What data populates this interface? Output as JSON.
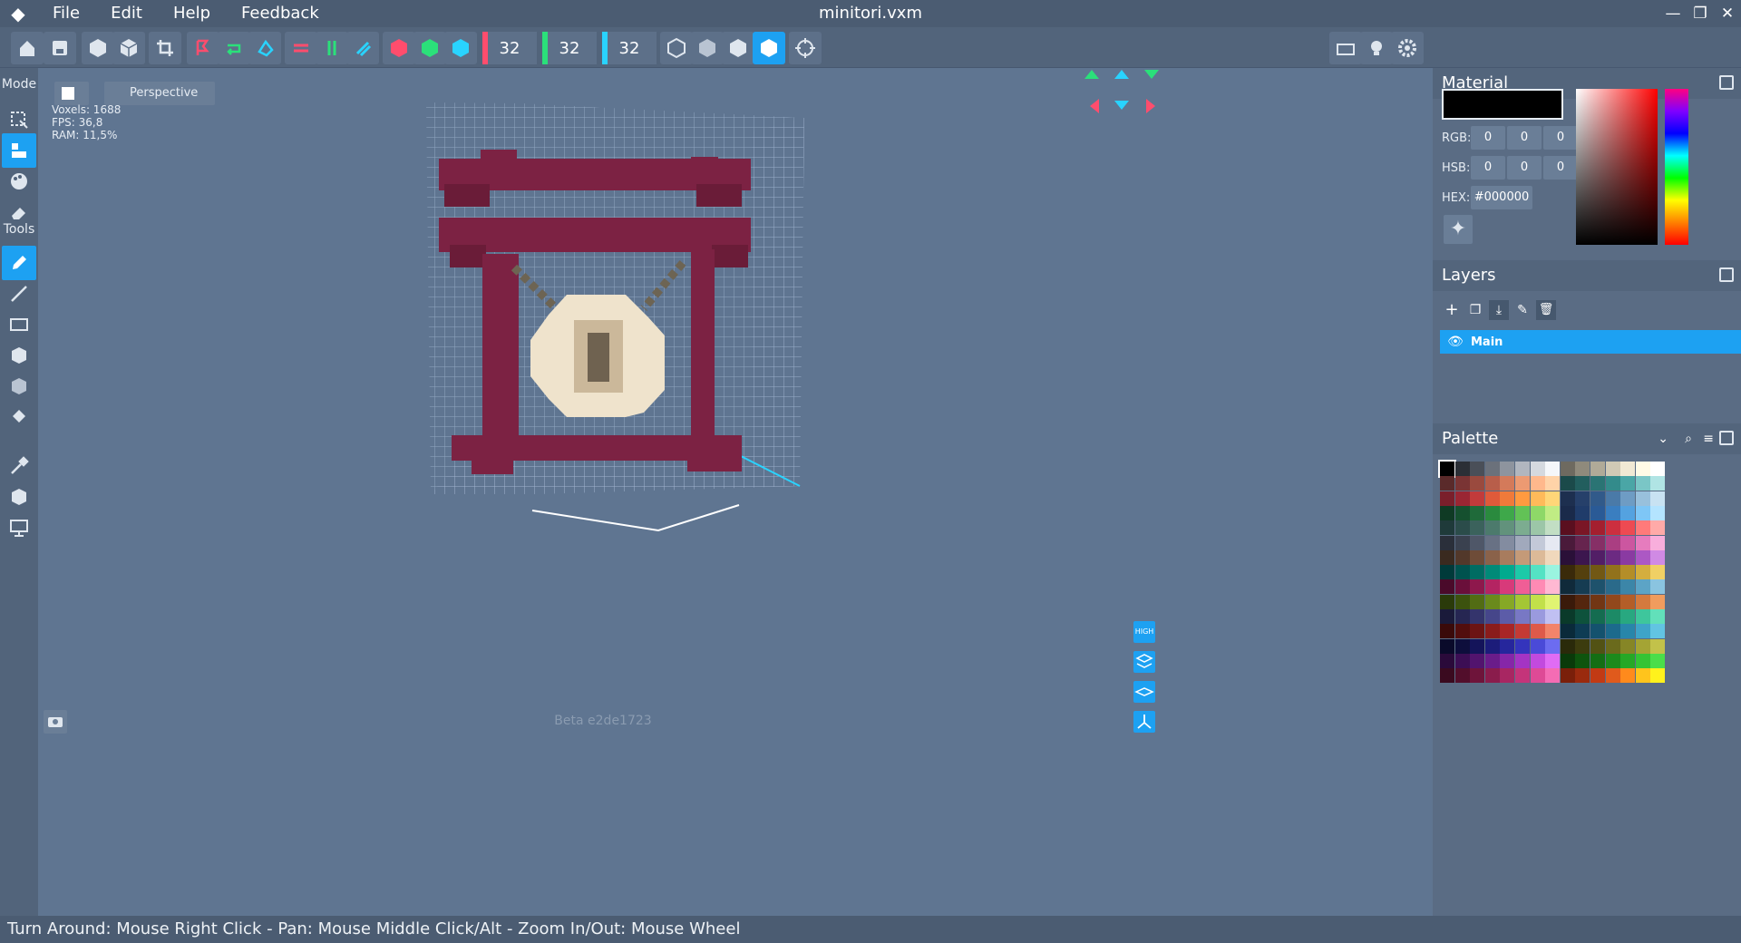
{
  "app": {
    "title": "minitori.vxm"
  },
  "menu": [
    "File",
    "Edit",
    "Help",
    "Feedback"
  ],
  "toolbar": {
    "dims": [
      "32",
      "32",
      "32"
    ],
    "dim_colors": [
      "#ff4d6d",
      "#2be07a",
      "#29d3ff"
    ]
  },
  "sidebar": {
    "mode_label": "Mode",
    "tools_label": "Tools"
  },
  "viewport": {
    "view_select": "Perspective",
    "stats": [
      "Voxels: 1688",
      "FPS: 36,8",
      "RAM: 11,5%"
    ],
    "version": "Beta e2de1723",
    "quality_badge": "HIGH"
  },
  "material": {
    "title": "Material",
    "rgb_label": "RGB:",
    "rgb": [
      "0",
      "0",
      "0"
    ],
    "hsb_label": "HSB:",
    "hsb": [
      "0",
      "0",
      "0"
    ],
    "hex_label": "HEX:",
    "hex": "#000000"
  },
  "layers": {
    "title": "Layers",
    "items": [
      "Main"
    ]
  },
  "palette": {
    "title": "Palette",
    "rows": [
      [
        "#000000",
        "#2b2f36",
        "#4a4f58",
        "#6b717b",
        "#8e949e",
        "#b1b6bf",
        "#d5d9df",
        "#f5f7fa",
        "#6e6a60",
        "#8f8a7c",
        "#b0aa98",
        "#d0c9b5",
        "#f0e9d4",
        "#fffbe6",
        "#ffffff"
      ],
      [
        "#5a2a2a",
        "#7a3434",
        "#9a4a3e",
        "#b85e4a",
        "#d47a5a",
        "#ec9a72",
        "#ffb88c",
        "#ffd3a8",
        "#1b4a4a",
        "#225e5e",
        "#2a7474",
        "#338b8b",
        "#4aa6a6",
        "#7ac6c6",
        "#b0e4e4"
      ],
      [
        "#7a1f2b",
        "#9a2633",
        "#c23b3b",
        "#e05a3a",
        "#f07a3a",
        "#ff9a40",
        "#ffba5a",
        "#ffd678",
        "#1d2f4f",
        "#26406a",
        "#315a8a",
        "#4a7aa8",
        "#6e9cc4",
        "#98c0dc",
        "#c8e2f2"
      ],
      [
        "#0f3a24",
        "#15502f",
        "#1f6a3a",
        "#2a8a3e",
        "#3ea84a",
        "#62c256",
        "#8ed868",
        "#c0ec84",
        "#1a2a4a",
        "#203c6a",
        "#2a5a96",
        "#3a7ec0",
        "#54a2e0",
        "#7ec6f6",
        "#b4e4ff"
      ],
      [
        "#1f3a3a",
        "#2b4c4a",
        "#3b625c",
        "#4c7a6c",
        "#62927c",
        "#7cac90",
        "#9cc6a8",
        "#c2dec4",
        "#5a0f1f",
        "#7a1626",
        "#a41f2f",
        "#cc2f3f",
        "#ee4a52",
        "#ff7a7a",
        "#ffaaa8"
      ],
      [
        "#2a2f3a",
        "#3a414f",
        "#4f5768",
        "#687184",
        "#838ca0",
        "#a1a9bc",
        "#c3c9d8",
        "#e6e9f2",
        "#4a1a3a",
        "#66244e",
        "#862f66",
        "#aa3e82",
        "#cc56a0",
        "#e67cbe",
        "#f8aedc"
      ],
      [
        "#3a2a1f",
        "#52382a",
        "#6e4c38",
        "#8a624a",
        "#a87c5e",
        "#c49a78",
        "#dcba98",
        "#f0d8bc",
        "#2a1038",
        "#3c164e",
        "#521e66",
        "#6c2a82",
        "#8a3aa2",
        "#ac58c4",
        "#d08ae4"
      ],
      [
        "#003a3a",
        "#00524e",
        "#006c62",
        "#008a78",
        "#00aa8e",
        "#1ccaa8",
        "#54e2c4",
        "#9af4e0",
        "#3a2a0a",
        "#54400e",
        "#725814",
        "#92721c",
        "#b48e28",
        "#d4ae3e",
        "#f0d064"
      ],
      [
        "#4a0a2a",
        "#6a0f3a",
        "#8e184c",
        "#b42462",
        "#d83a7a",
        "#f05e96",
        "#ff8ab4",
        "#ffb8d2",
        "#102a3a",
        "#163c52",
        "#1e526c",
        "#2a6a8a",
        "#3c86a8",
        "#5ca4c6",
        "#8ac4e0"
      ],
      [
        "#2a3a0a",
        "#3c520e",
        "#526c14",
        "#6a8a1c",
        "#86a826",
        "#a4c634",
        "#c2e04a",
        "#e0f472",
        "#3a1a0a",
        "#54260e",
        "#723614",
        "#92481c",
        "#b45e28",
        "#d47a3e",
        "#f09c5e"
      ],
      [
        "#1a1a3a",
        "#262652",
        "#34346c",
        "#46468a",
        "#5c5ca8",
        "#7878c4",
        "#9a9ade",
        "#c0c0f2",
        "#0a3a2a",
        "#0e523c",
        "#146c50",
        "#1c8a66",
        "#28a880",
        "#3ec69c",
        "#62e0ba"
      ],
      [
        "#3a0a0a",
        "#520e0e",
        "#6c1414",
        "#8a1c1c",
        "#a82626",
        "#c43a34",
        "#de5a4a",
        "#f2846a",
        "#0a2a3a",
        "#0e3c54",
        "#14526e",
        "#1c6a8c",
        "#2886aa",
        "#3ea4c8",
        "#62c4e2"
      ],
      [
        "#0a0a2a",
        "#0e0e3c",
        "#14145a",
        "#1c1c7a",
        "#26269c",
        "#3434bc",
        "#4a4ad8",
        "#6c6cf0",
        "#2a2a0a",
        "#3c3c0e",
        "#525214",
        "#6a6a1c",
        "#868626",
        "#a4a434",
        "#c2c24a"
      ],
      [
        "#2a0a3a",
        "#3c0e54",
        "#52146e",
        "#6a1c8a",
        "#8626a8",
        "#a434c4",
        "#c24ade",
        "#e06cf4",
        "#0a3a0a",
        "#0e540e",
        "#146e14",
        "#1c8a1c",
        "#26a826",
        "#34c434",
        "#4ade4a"
      ],
      [
        "#3a0a1f",
        "#520e2b",
        "#6e143a",
        "#8a1c4c",
        "#a82662",
        "#c4347a",
        "#de4a96",
        "#f46cb4",
        "#7a1f0a",
        "#9a2a0e",
        "#c23a14",
        "#e05a1c",
        "#ff8a1c",
        "#ffc41c",
        "#fff21c"
      ]
    ]
  }
}
